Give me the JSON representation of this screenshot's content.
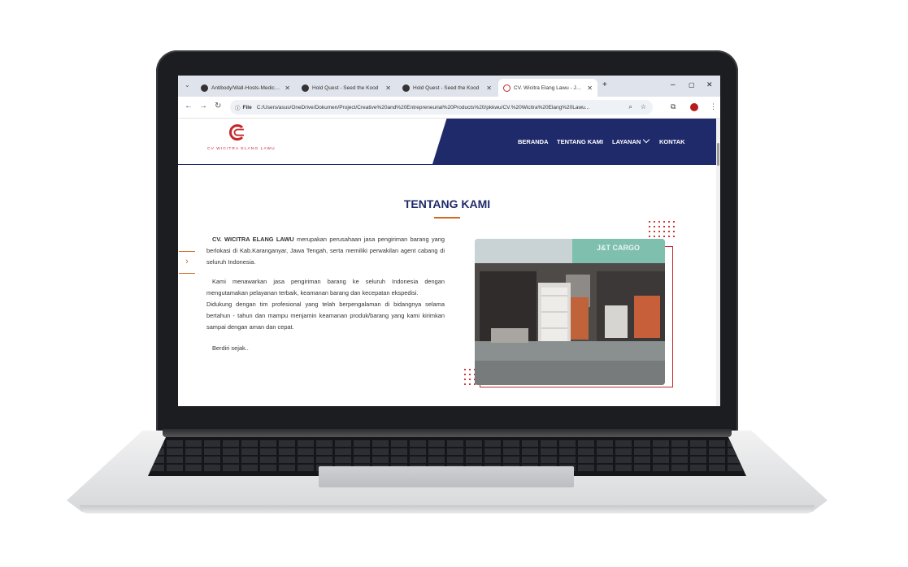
{
  "browser": {
    "tabs": [
      {
        "title": "Antibody/Wall-Hosts-Medicaid/"
      },
      {
        "title": "Hold Quest - Seed the Kood"
      },
      {
        "title": "Hold Quest - Seed the Kood"
      },
      {
        "title": "CV. Wicitra Elang Lawu - Jasa P"
      }
    ],
    "new_tab": "+",
    "url_scheme": "File",
    "url": "C:/Users/asus/OneDrive/Dokumen/Project/Creative%20and%20Entrepreneurial%20Products%20/pkkwu/CV.%20Wicitra%20Elang%20Lawu...",
    "window_controls": {
      "minimize": "–",
      "maximize": "▢",
      "close": "✕"
    }
  },
  "site": {
    "logo_text": "CV WICITRA ELANG LAWU",
    "nav": {
      "beranda": "BERANDA",
      "tentang": "TENTANG KAMI",
      "layanan": "LAYANAN",
      "kontak": "KONTAK"
    },
    "brand_colors": {
      "navy": "#1f2a6b",
      "red": "#c62828",
      "accent": "#d2691e"
    }
  },
  "about": {
    "title": "TENTANG KAMI",
    "company": "CV. WICITRA ELANG LAWU",
    "p1": "merupakan perusahaan jasa pengiriman barang yang berlokasi di Kab.Karanganyar, Jawa Tengah, serta memiliki perwakilan agent cabang di seluruh Indonesia.",
    "p2": "Kami menawarkan jasa pengiriman barang ke seluruh Indonesia dengan mengutamakan pelayanan terbaik, keamanan barang dan kecepatan ekspedisi.",
    "p3": "Didukung dengan tim profesional yang telah berpengalaman di bidangnya selama bertahun - tahun dan mampu menjamin keamanan produk/barang yang kami kirimkan sampai dengan aman dan cepat.",
    "p4": "Berdiri sejak..",
    "photo_sign": "J&T CARGO"
  }
}
